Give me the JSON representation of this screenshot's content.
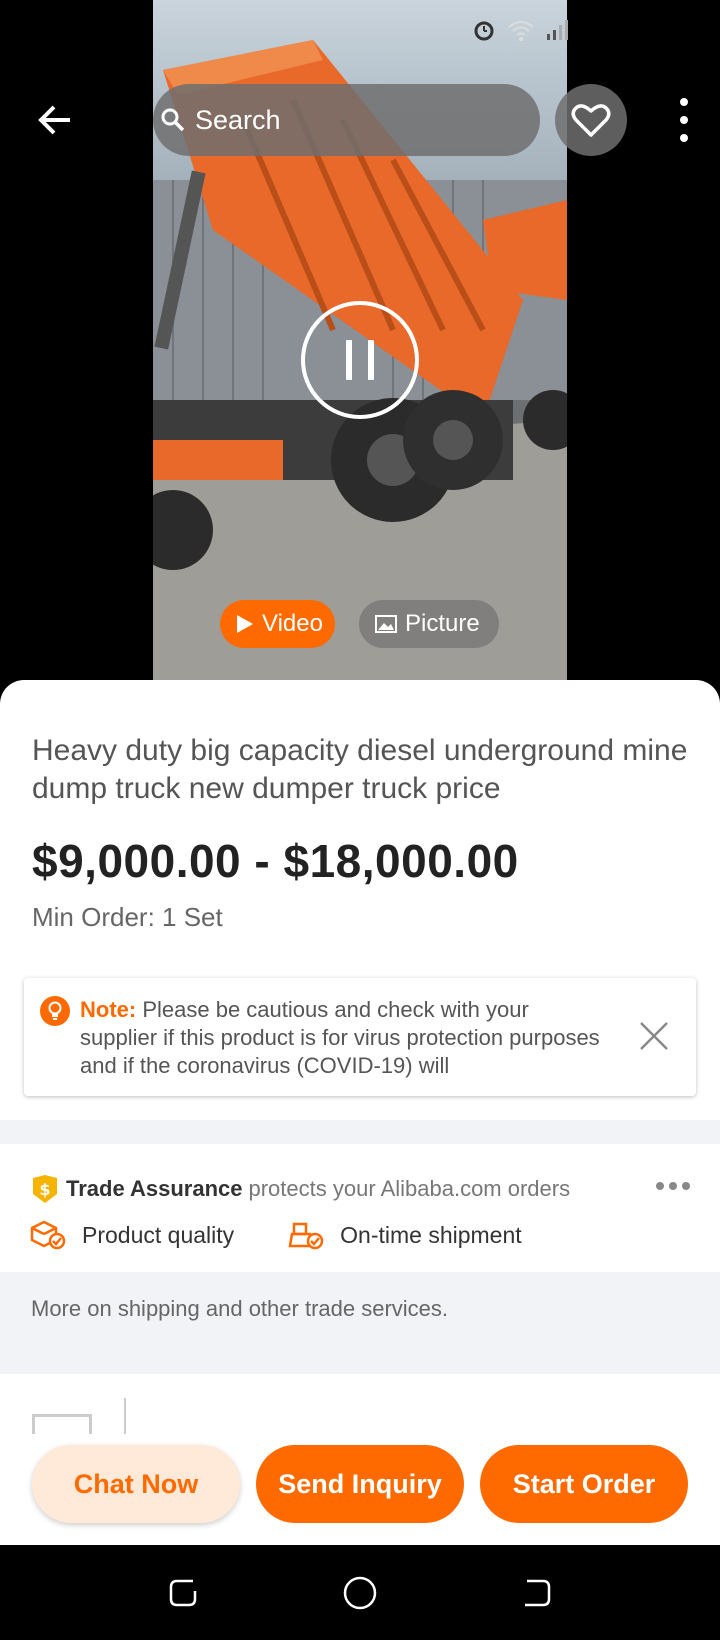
{
  "header": {
    "search_placeholder": "Search"
  },
  "media": {
    "tabs": [
      {
        "label": "Video",
        "active": true
      },
      {
        "label": "Picture",
        "active": false
      }
    ]
  },
  "product": {
    "title": "Heavy duty big capacity diesel underground mine dump truck new dumper truck price",
    "price_range": "$9,000.00 - $18,000.00",
    "min_order": "Min Order: 1 Set"
  },
  "note": {
    "label": "Note:",
    "text": "Please be cautious and check with your supplier if this product is for virus protection purposes and if the coronavirus (COVID-19) will"
  },
  "trade_assurance": {
    "name": "Trade Assurance",
    "tagline": "protects your Alibaba.com orders",
    "features": [
      "Product quality",
      "On-time shipment"
    ]
  },
  "shipping_link": "More on shipping and other trade services.",
  "actions": {
    "chat": "Chat Now",
    "inquiry": "Send Inquiry",
    "order": "Start Order"
  },
  "colors": {
    "accent": "#ff6a00",
    "accent_light": "#ffe9d9",
    "divider_bg": "#f2f3f7"
  }
}
